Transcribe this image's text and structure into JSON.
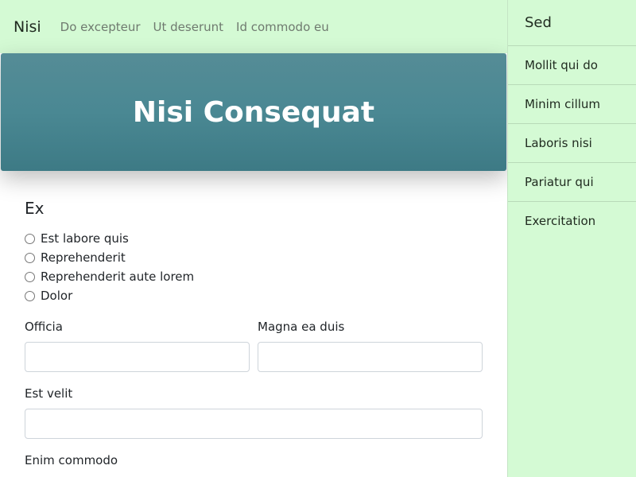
{
  "navbar": {
    "brand": "Nisi",
    "links": [
      "Do excepteur",
      "Ut deserunt",
      "Id commodo eu"
    ]
  },
  "hero": {
    "title": "Nisi Consequat"
  },
  "form": {
    "section_title": "Ex",
    "radios": [
      "Est labore quis",
      "Reprehenderit",
      "Reprehenderit aute lorem",
      "Dolor"
    ],
    "field_officia": {
      "label": "Officia",
      "value": "",
      "placeholder": ""
    },
    "field_magna": {
      "label": "Magna ea duis",
      "value": "",
      "placeholder": ""
    },
    "field_est_velit": {
      "label": "Est velit",
      "value": "",
      "placeholder": ""
    },
    "field_enim": {
      "label": "Enim commodo"
    }
  },
  "sidebar": {
    "title": "Sed",
    "items": [
      "Mollit qui do",
      "Minim cillum",
      "Laboris nisi",
      "Pariatur qui",
      "Exercitation"
    ]
  },
  "colors": {
    "nav_bg": "#d4fad4",
    "hero_bg": "#4a8893",
    "sidebar_bg": "#d4fad4"
  }
}
